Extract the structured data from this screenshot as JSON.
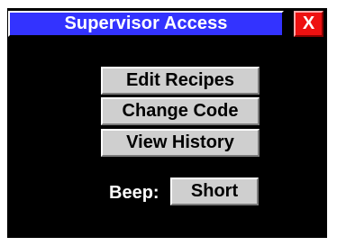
{
  "title_bar": {
    "title": "Supervisor Access",
    "close_label": "X"
  },
  "menu": {
    "items": [
      {
        "label": "Edit Recipes"
      },
      {
        "label": "Change Code"
      },
      {
        "label": "View History"
      }
    ]
  },
  "beep": {
    "label": "Beep:",
    "value": "Short"
  },
  "colors": {
    "background": "#000000",
    "title_bar": "#3333ff",
    "close_button": "#ee1111",
    "button_face": "#cfcfcf",
    "text_light": "#ffffff",
    "text_dark": "#000000"
  },
  "icons": {
    "close": "close-icon"
  }
}
